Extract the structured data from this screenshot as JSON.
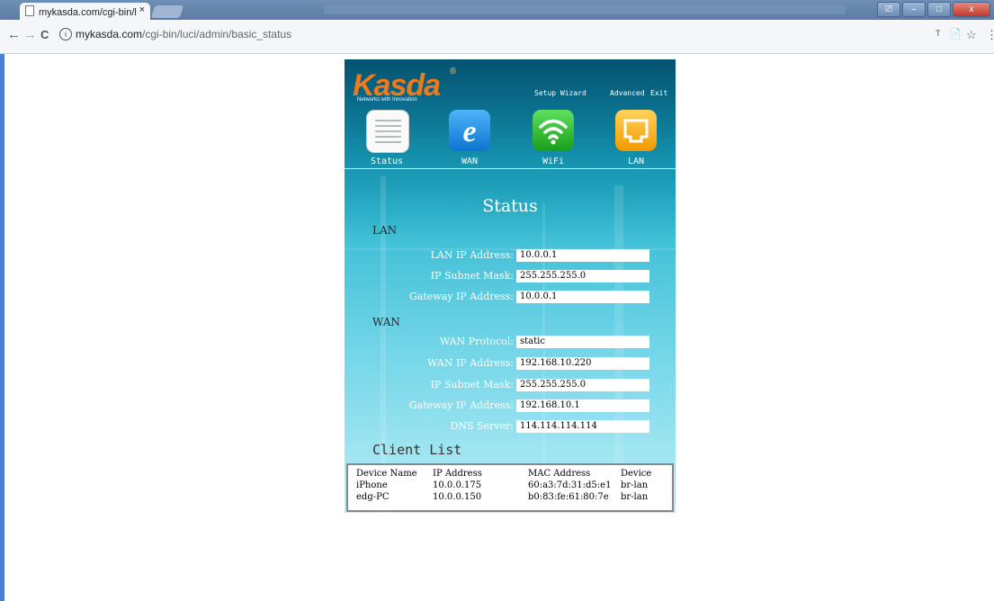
{
  "browser": {
    "tab_title": "mykasda.com/cgi-bin/l",
    "tab_close": "×",
    "url_host": "mykasda.com",
    "url_path": "/cgi-bin/luci/admin/basic_status",
    "back_glyph": "←",
    "forward_glyph": "→",
    "reload_glyph": "C",
    "info_glyph": "i",
    "window_controls": [
      "⎚",
      "–",
      "□",
      "x"
    ],
    "toolbar_icons": [
      "ᵀ",
      "📄",
      "☆",
      "⋮"
    ]
  },
  "router": {
    "logo": "Kasda",
    "logo_reg": "®",
    "tagline": "Networks with Innovation",
    "top_links": [
      "Setup Wizard",
      "Advanced",
      "Exit"
    ],
    "nav_tabs": [
      {
        "label": "Status",
        "icon": "list-icon",
        "color": "#ffffff"
      },
      {
        "label": "WAN",
        "icon": "internet-explorer-icon",
        "color": "#1a8fe0"
      },
      {
        "label": "WiFi",
        "icon": "wifi-icon",
        "color": "#2bbf2b"
      },
      {
        "label": "LAN",
        "icon": "ethernet-port-icon",
        "color": "#f2a600"
      }
    ],
    "title": "Status",
    "lan": {
      "heading": "LAN",
      "fields": [
        {
          "label": "LAN IP Address:",
          "value": "10.0.0.1"
        },
        {
          "label": "IP Subnet Mask:",
          "value": "255.255.255.0"
        },
        {
          "label": "Gateway IP Address:",
          "value": "10.0.0.1"
        }
      ]
    },
    "wan": {
      "heading": "WAN",
      "fields": [
        {
          "label": "WAN Protocol:",
          "value": "static"
        },
        {
          "label": "WAN IP Address:",
          "value": "192.168.10.220"
        },
        {
          "label": "IP Subnet Mask:",
          "value": "255.255.255.0"
        },
        {
          "label": "Gateway IP Address:",
          "value": "192.168.10.1"
        },
        {
          "label": "DNS Server:",
          "value": "114.114.114.114"
        }
      ]
    },
    "client_list": {
      "title": "Client List",
      "headers": [
        "Device Name",
        "IP Address",
        "MAC Address",
        "Device"
      ],
      "rows": [
        [
          "iPhone",
          "10.0.0.175",
          "60:a3:7d:31:d5:e1",
          "br-lan"
        ],
        [
          "edg-PC",
          "10.0.0.150",
          "b0:83:fe:61:80:7e",
          "br-lan"
        ]
      ]
    }
  }
}
